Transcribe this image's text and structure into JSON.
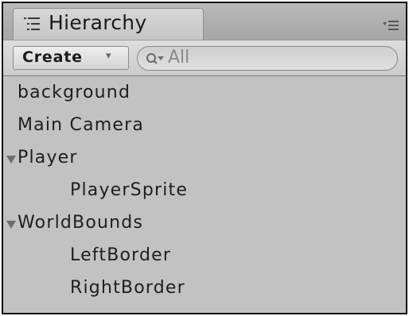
{
  "panel": {
    "title": "Hierarchy",
    "tab_icon": "hierarchy-list-icon",
    "menu_icon": "panel-menu-icon"
  },
  "toolbar": {
    "create_label": "Create",
    "create_caret": "▾",
    "search_placeholder": "All",
    "search_icon": "search-dropdown-icon"
  },
  "tree": {
    "items": [
      {
        "label": "background",
        "depth": 0,
        "expanded": null
      },
      {
        "label": "Main Camera",
        "depth": 0,
        "expanded": null
      },
      {
        "label": "Player",
        "depth": 0,
        "expanded": true
      },
      {
        "label": "PlayerSprite",
        "depth": 1,
        "expanded": null
      },
      {
        "label": "WorldBounds",
        "depth": 0,
        "expanded": true
      },
      {
        "label": "LeftBorder",
        "depth": 1,
        "expanded": null
      },
      {
        "label": "RightBorder",
        "depth": 1,
        "expanded": null
      }
    ]
  },
  "colors": {
    "panel_background": "#c2c2c2",
    "text": "#1e1e1e",
    "foldout_arrow": "#6e6e6e"
  }
}
